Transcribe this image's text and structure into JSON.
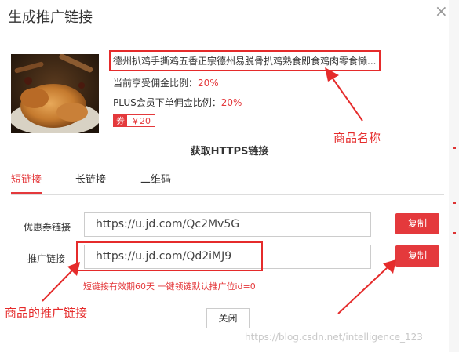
{
  "dialog": {
    "title": "生成推广链接",
    "close_icon": "×"
  },
  "product": {
    "name": "德州扒鸡手撕鸡五香正宗德州易脱骨扒鸡熟食即食鸡肉零食懒...",
    "commission_label": "当前享受佣金比例：",
    "commission_value": "20%",
    "plus_label": "PLUS会员下单佣金比例：",
    "plus_value": "20%",
    "coupon_tag": "券",
    "coupon_amount": "￥20"
  },
  "annotations": {
    "product_name": "商品名称",
    "promo_link": "商品的推广链接"
  },
  "section_title": "获取HTTPS链接",
  "tabs": [
    {
      "label": "短链接",
      "active": true
    },
    {
      "label": "长链接",
      "active": false
    },
    {
      "label": "二维码",
      "active": false
    }
  ],
  "coupon_link": {
    "label": "优惠券链接",
    "value": "https://u.jd.com/Qc2Mv5G",
    "copy": "复制"
  },
  "promo_link": {
    "label": "推广链接",
    "value": "https://u.jd.com/Qd2iMJ9",
    "copy": "复制"
  },
  "note": "短链接有效期60天   一键领链默认推广位id=0",
  "close_button": "关闭",
  "watermark": "https://blog.csdn.net/intelligence_123",
  "colors": {
    "accent": "#e4393c",
    "annotation": "#e52b2b"
  }
}
